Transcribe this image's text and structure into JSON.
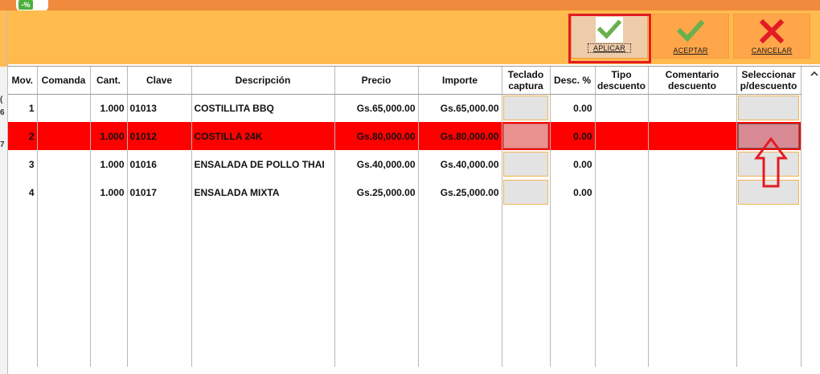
{
  "app": {
    "badge_text": "-%"
  },
  "left_sliver": {
    "chars": [
      "(",
      "6",
      "7"
    ]
  },
  "toolbar": {
    "aplicar_label": "APLICAR",
    "aceptar_label": "ACEPTAR",
    "cancelar_label": "CANCELAR",
    "colors": {
      "toolbar_bg": "#ffbb4e",
      "button_bg": "#ffa64a",
      "check_green": "#6ab04c",
      "cancel_red": "#e31b23"
    },
    "icons": {
      "aplicar": "check-icon",
      "aceptar": "check-icon",
      "cancelar": "x-icon"
    }
  },
  "table": {
    "columns": [
      {
        "key": "mov",
        "label": "Mov."
      },
      {
        "key": "comanda",
        "label": "Comanda"
      },
      {
        "key": "cant",
        "label": "Cant."
      },
      {
        "key": "clave",
        "label": "Clave"
      },
      {
        "key": "descripcion",
        "label": "Descripción"
      },
      {
        "key": "precio",
        "label": "Precio"
      },
      {
        "key": "importe",
        "label": "Importe"
      },
      {
        "key": "teclado",
        "label_line1": "Teclado",
        "label_line2": "captura"
      },
      {
        "key": "desc_pct",
        "label": "Desc. %"
      },
      {
        "key": "tipo",
        "label_line1": "Tipo",
        "label_line2": "descuento"
      },
      {
        "key": "comentario",
        "label_line1": "Comentario",
        "label_line2": "descuento"
      },
      {
        "key": "seleccionar",
        "label_line1": "Seleccionar",
        "label_line2": "p/descuento"
      }
    ],
    "rows": [
      {
        "mov": "1",
        "comanda": "",
        "cant": "1.000",
        "clave": "01013",
        "descripcion": "COSTILLITA BBQ",
        "precio": "Gs.65,000.00",
        "importe": "Gs.65,000.00",
        "desc_pct": "0.00",
        "tipo": "",
        "comentario": ""
      },
      {
        "mov": "2",
        "comanda": "",
        "cant": "1.000",
        "clave": "01012",
        "descripcion": "COSTILLA 24K",
        "precio": "Gs.80,000.00",
        "importe": "Gs.80,000.00",
        "desc_pct": "0.00",
        "tipo": "",
        "comentario": "",
        "selected": true
      },
      {
        "mov": "3",
        "comanda": "",
        "cant": "1.000",
        "clave": "01016",
        "descripcion": "ENSALADA DE POLLO THAI",
        "precio": "Gs.40,000.00",
        "importe": "Gs.40,000.00",
        "desc_pct": "0.00",
        "tipo": "",
        "comentario": ""
      },
      {
        "mov": "4",
        "comanda": "",
        "cant": "1.000",
        "clave": "01017",
        "descripcion": "ENSALADA MIXTA",
        "precio": "Gs.25,000.00",
        "importe": "Gs.25,000.00",
        "desc_pct": "0.00",
        "tipo": "",
        "comentario": ""
      }
    ],
    "selected_row_color": "#ff0000"
  },
  "annotations": {
    "highlight_color": "#e31b23",
    "arrow_icon": "up-arrow-outline-icon"
  }
}
